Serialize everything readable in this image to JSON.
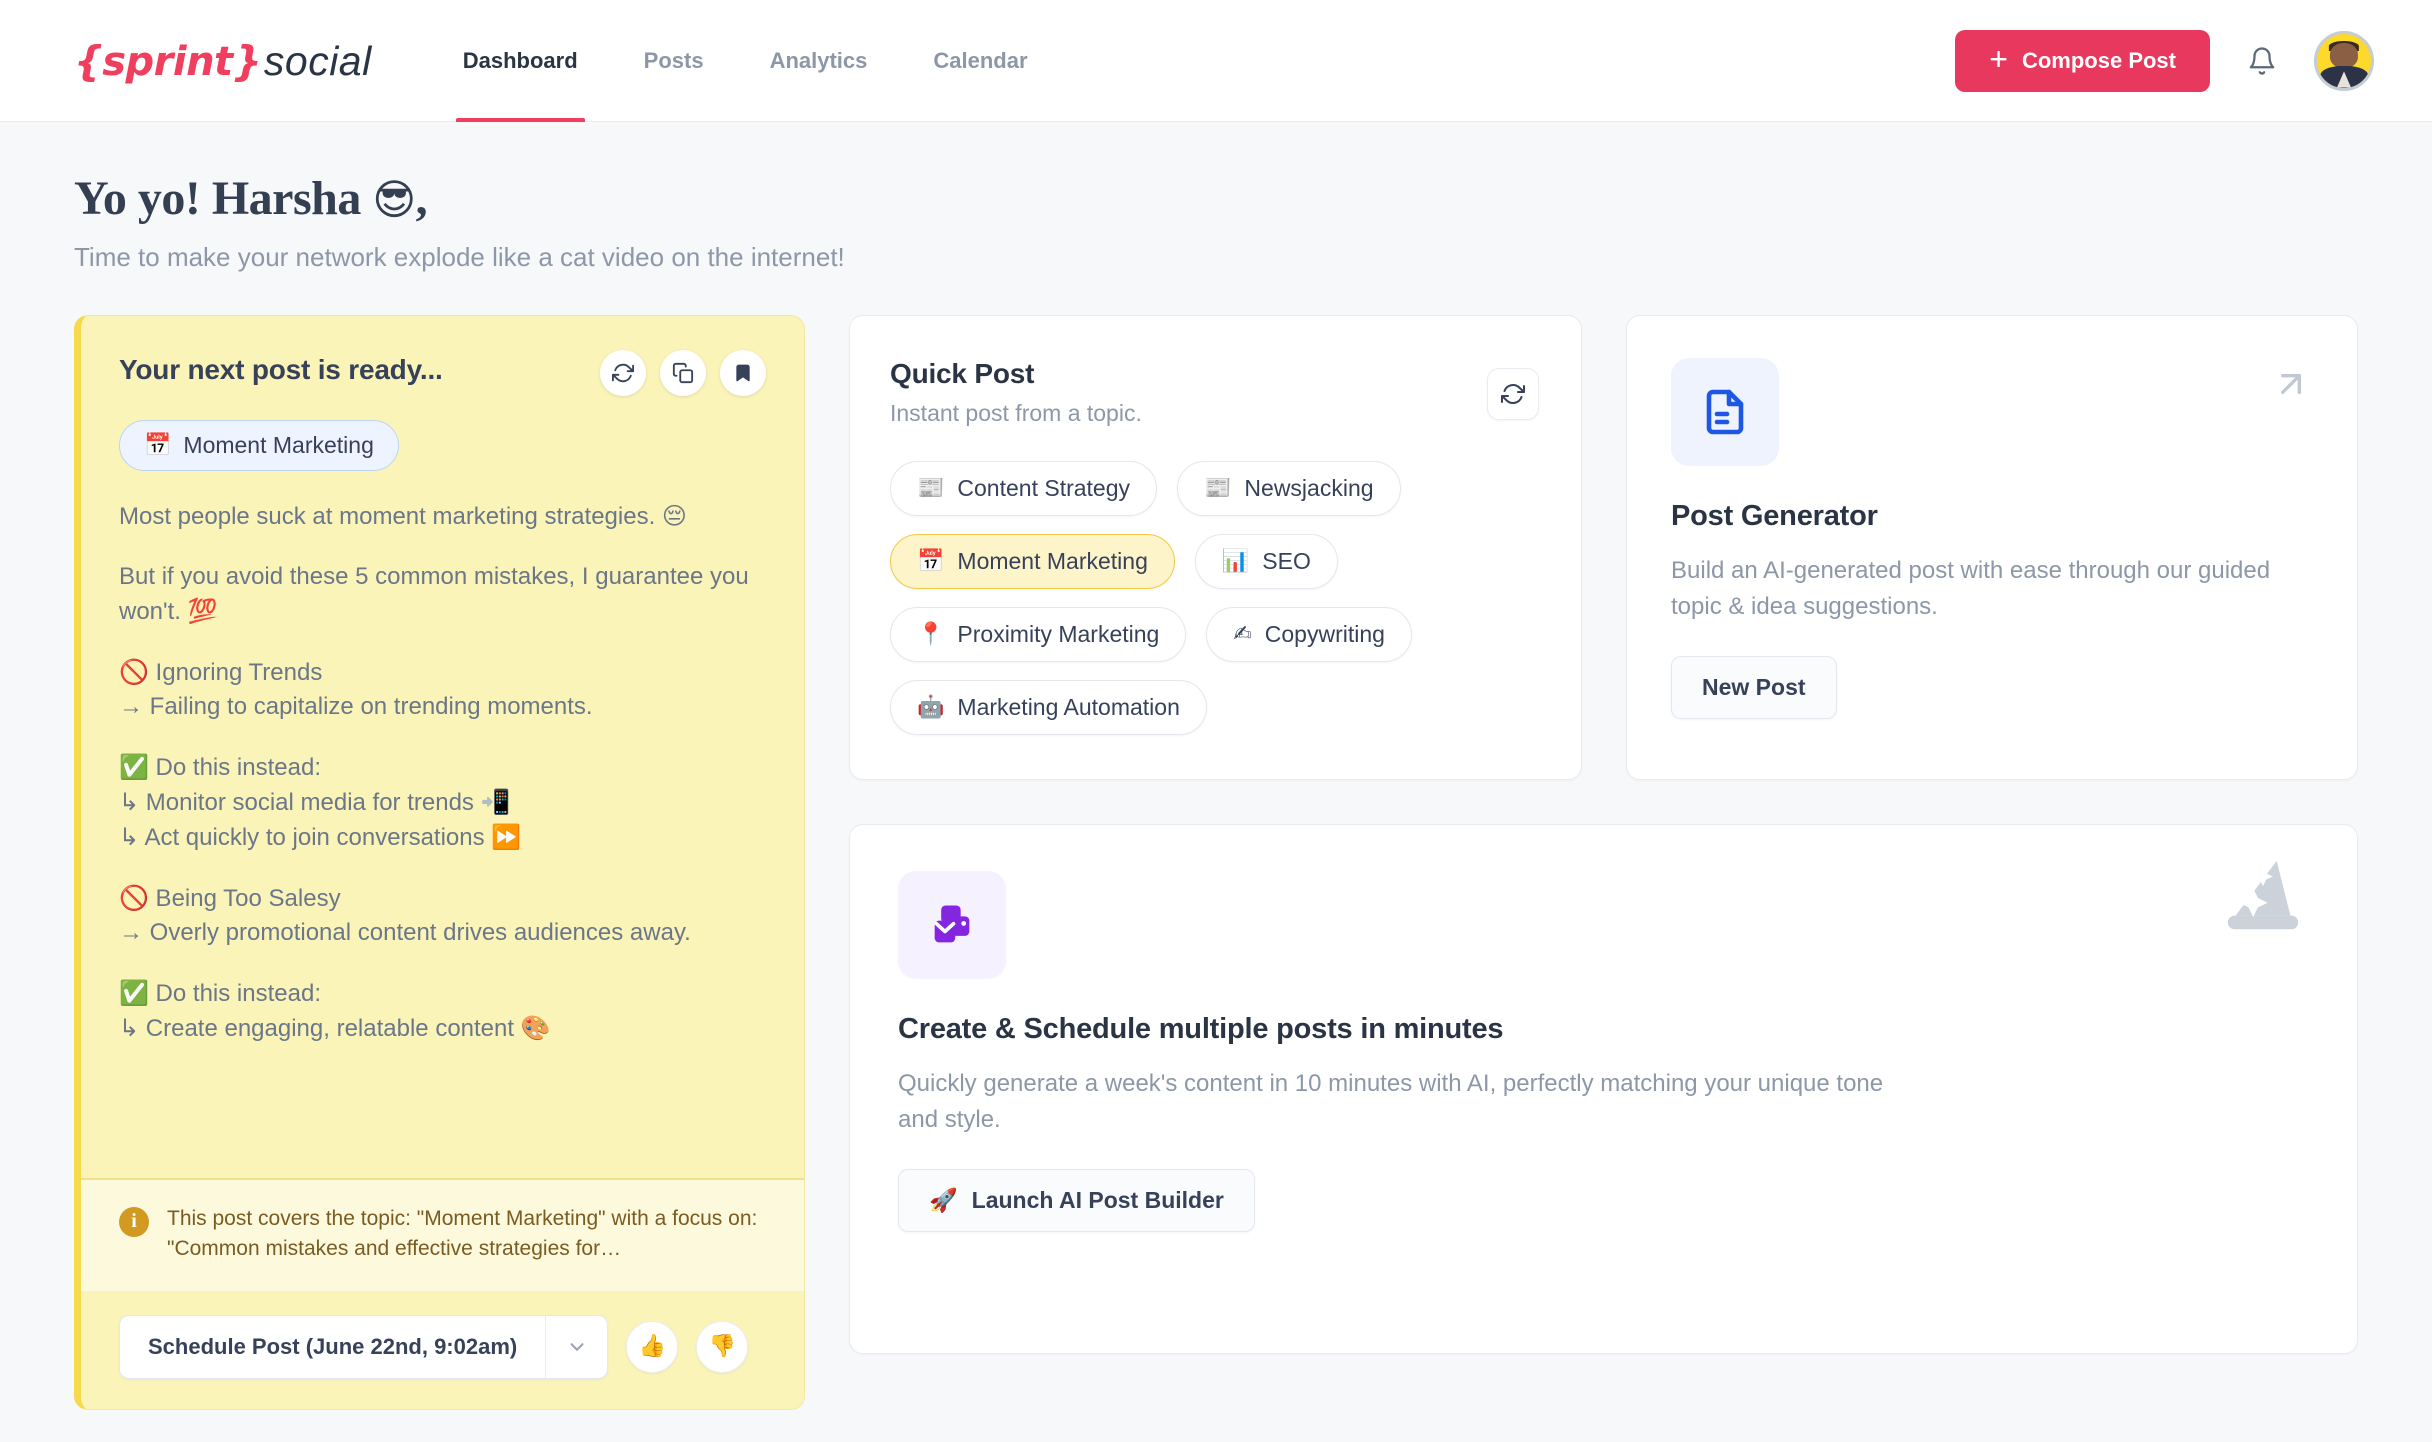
{
  "header": {
    "logo": {
      "brace_open": "{",
      "sprint": "sprint",
      "brace_close": "}",
      "social": "social"
    },
    "nav": [
      {
        "label": "Dashboard",
        "active": true
      },
      {
        "label": "Posts",
        "active": false
      },
      {
        "label": "Analytics",
        "active": false
      },
      {
        "label": "Calendar",
        "active": false
      }
    ],
    "compose_label": "Compose Post",
    "compose_plus": "+",
    "compose_color": "#e8385e",
    "bell_icon": "bell-icon",
    "avatar_icon": "user-avatar"
  },
  "greeting": {
    "title": "Yo yo! Harsha",
    "title_emoji": "😎",
    "title_comma": ",",
    "subtitle": "Time to make your network explode like a cat video on the internet!"
  },
  "post_card": {
    "title": "Your next post is ready...",
    "actions": [
      {
        "name": "regenerate-icon"
      },
      {
        "name": "copy-icon"
      },
      {
        "name": "bookmark-icon"
      }
    ],
    "tag": {
      "emoji": "📅",
      "label": "Moment Marketing"
    },
    "body": {
      "p1": "Most people suck at moment marketing strategies.",
      "p1_emoji": "😔",
      "p2_a": "But if you avoid these 5 common mistakes, I guarantee you won't. ",
      "p2_emoji": "💯",
      "p3_emoji": "🚫",
      "p3_a": " Ignoring Trends",
      "p3_b": "→ Failing to capitalize on trending moments.",
      "p4_emoji": "✅",
      "p4_a": " Do this instead:",
      "p4_b": "↳ Monitor social media for trends ",
      "p4_b_emoji": "📲",
      "p4_c": "↳ Act quickly to join conversations ",
      "p4_c_emoji": "⏩",
      "p5_emoji": "🚫",
      "p5_a": " Being Too Salesy",
      "p5_b": "→ Overly promotional content drives audiences away.",
      "p6_emoji": "✅",
      "p6_a": " Do this instead:",
      "p6_b": "↳ Create engaging, relatable content ",
      "p6_b_emoji": "🎨"
    },
    "note": {
      "icon": "info-icon",
      "text": "This post covers the topic: \"Moment Marketing\" with a focus on: \"Common mistakes and effective strategies for…"
    },
    "schedule_label": "Schedule Post (June 22nd, 9:02am)",
    "caret_icon": "chevron-down-icon",
    "thumbs_up": "👍",
    "thumbs_down": "👎"
  },
  "quick_post": {
    "title": "Quick Post",
    "subtitle": "Instant post from a topic.",
    "refresh_icon": "refresh-icon",
    "topics": [
      {
        "emoji": "📰",
        "label": "Content Strategy",
        "selected": false
      },
      {
        "emoji": "📰",
        "label": "Newsjacking",
        "selected": false
      },
      {
        "emoji": "📅",
        "label": "Moment Marketing",
        "selected": true
      },
      {
        "emoji": "📊",
        "label": "SEO",
        "selected": false
      },
      {
        "emoji": "📍",
        "label": "Proximity Marketing",
        "selected": false
      },
      {
        "emoji": "✍",
        "label": "Copywriting",
        "selected": false
      },
      {
        "emoji": "🤖",
        "label": "Marketing Automation",
        "selected": false
      }
    ]
  },
  "post_generator": {
    "icon": "document-icon",
    "corner_icon": "arrow-up-right-icon",
    "title": "Post Generator",
    "description": "Build an AI-generated post with ease through our guided topic & idea suggestions.",
    "button_label": "New Post",
    "accent_color": "#1f56e3"
  },
  "ai_builder": {
    "icon": "mail-stack-icon",
    "corner_icon": "wizard-hat-icon",
    "title": "Create & Schedule multiple posts in minutes",
    "description": "Quickly generate a week's content in 10 minutes with AI, perfectly matching your unique tone and style.",
    "button_emoji": "🚀",
    "button_label": "Launch AI Post Builder",
    "accent_color": "#8426e0"
  }
}
